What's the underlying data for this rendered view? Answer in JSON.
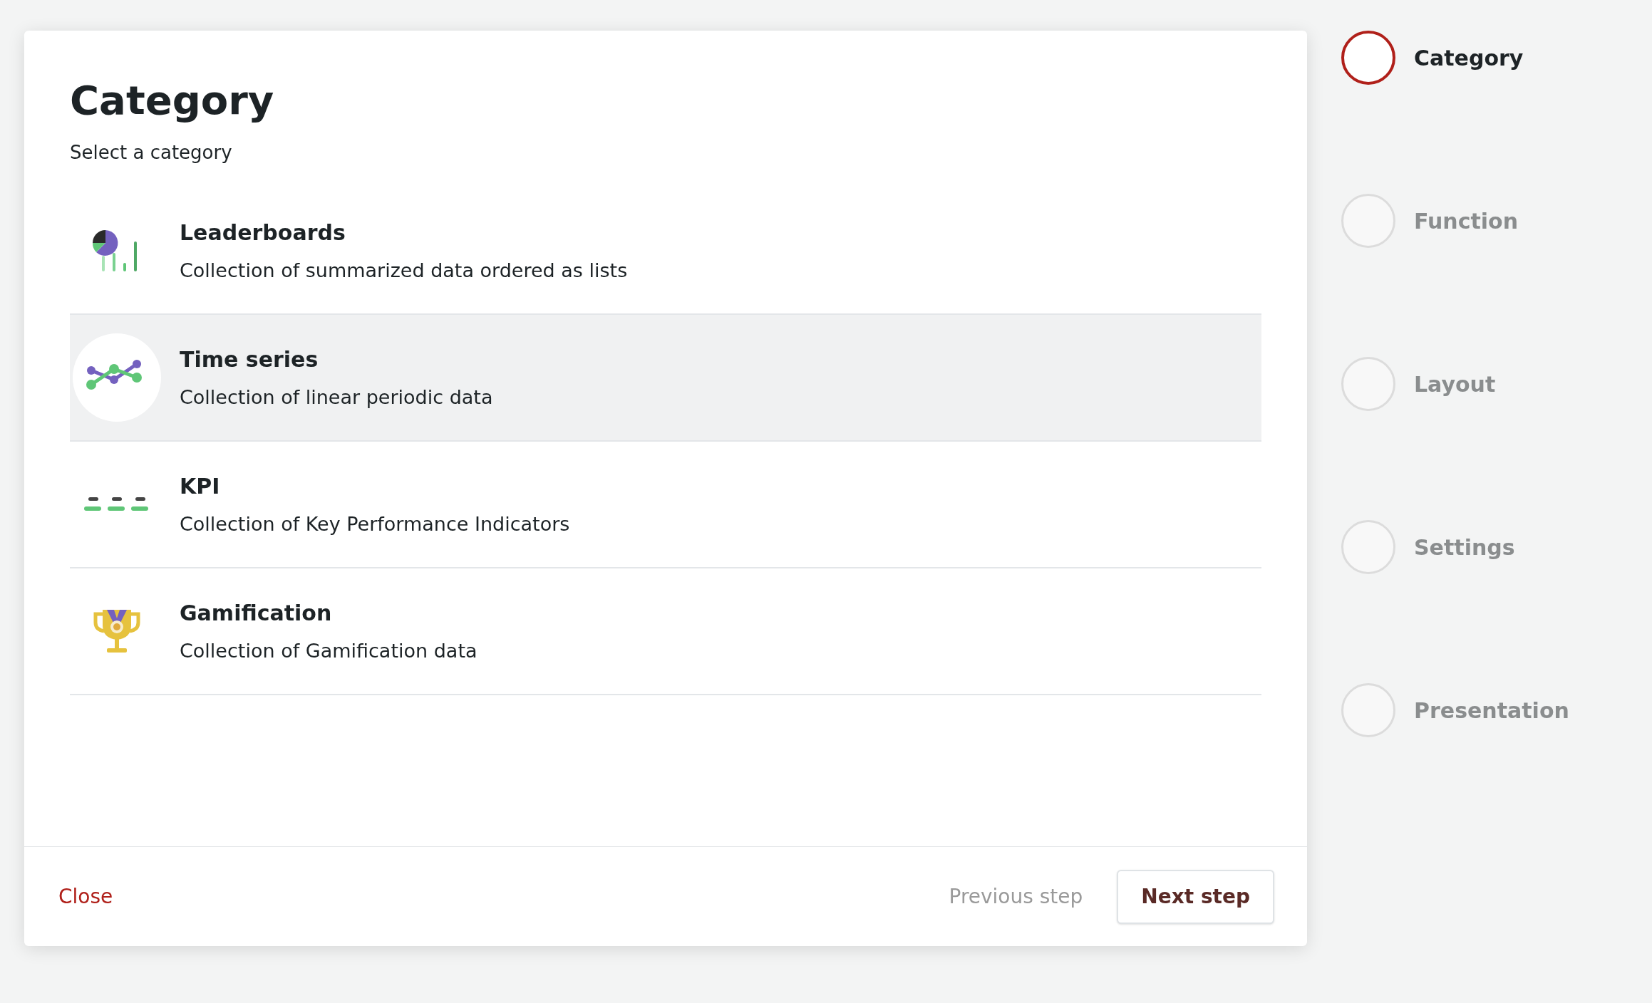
{
  "dialog": {
    "title": "Category",
    "subtitle": "Select a category",
    "categories": [
      {
        "kind": "leaderboards",
        "title": "Leaderboards",
        "description": "Collection of summarized data ordered as lists",
        "selected": false
      },
      {
        "kind": "time_series",
        "title": "Time series",
        "description": "Collection of linear periodic data",
        "selected": true
      },
      {
        "kind": "kpi",
        "title": "KPI",
        "description": "Collection of Key Performance Indicators",
        "selected": false
      },
      {
        "kind": "gamification",
        "title": "Gamification",
        "description": "Collection of Gamification data",
        "selected": false
      }
    ],
    "footer": {
      "close": "Close",
      "previous": "Previous step",
      "next": "Next step"
    }
  },
  "steps": [
    {
      "label": "Category",
      "selected": true
    },
    {
      "label": "Function",
      "selected": false
    },
    {
      "label": "Layout",
      "selected": false
    },
    {
      "label": "Settings",
      "selected": false
    },
    {
      "label": "Presentation",
      "selected": false
    }
  ]
}
